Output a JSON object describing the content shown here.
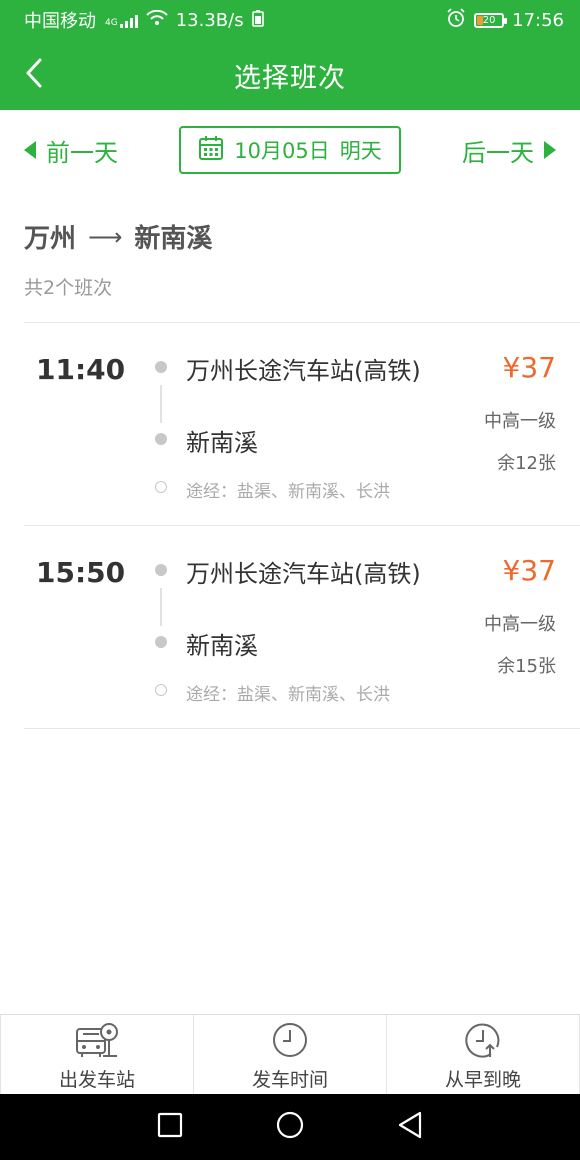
{
  "status_bar": {
    "carrier": "中国移动",
    "network": "4G",
    "speed": "13.3B/s",
    "battery": "20",
    "time": "17:56"
  },
  "header": {
    "title": "选择班次",
    "back_icon": "chevron-left-icon"
  },
  "date_bar": {
    "prev_label": "前一天",
    "date": "10月05日",
    "day_label": "明天",
    "next_label": "后一天"
  },
  "route": {
    "from": "万州",
    "arrow": "⟶",
    "to": "新南溪",
    "count_text": "共2个班次"
  },
  "trips": [
    {
      "time": "11:40",
      "from_station": "万州长途汽车站(高铁)",
      "to_station": "新南溪",
      "via": "途经：盐渠、新南溪、长洪",
      "price": "¥37",
      "grade": "中高一级",
      "seats": "余12张"
    },
    {
      "time": "15:50",
      "from_station": "万州长途汽车站(高铁)",
      "to_station": "新南溪",
      "via": "途经：盐渠、新南溪、长洪",
      "price": "¥37",
      "grade": "中高一级",
      "seats": "余15张"
    }
  ],
  "filters": [
    {
      "label": "出发车站",
      "icon": "bus-station-icon"
    },
    {
      "label": "发车时间",
      "icon": "clock-icon"
    },
    {
      "label": "从早到晚",
      "icon": "clock-sort-icon"
    }
  ],
  "colors": {
    "brand": "#2db13f",
    "price": "#ee6a2c"
  }
}
